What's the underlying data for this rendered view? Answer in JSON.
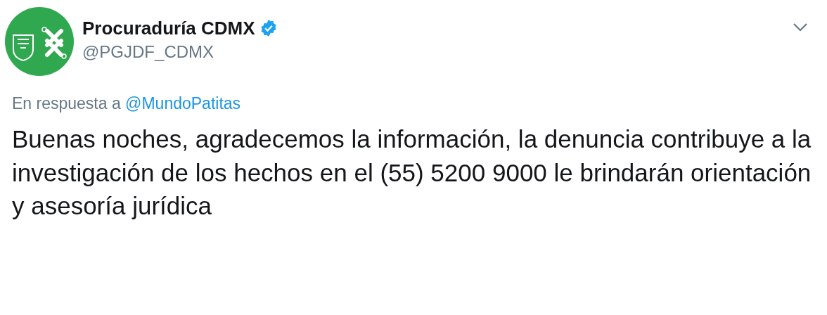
{
  "author": {
    "name": "Procuraduría CDMX",
    "verified": true,
    "handle": "@PGJDF_CDMX"
  },
  "reply_to": {
    "label": "En respuesta a",
    "mention": "@MundoPatitas"
  },
  "body": "Buenas noches, agradecemos la información, la denuncia contribuye a la investigación de los hechos en el (55) 5200 9000 le brindarán orientación y asesoría jurídica"
}
